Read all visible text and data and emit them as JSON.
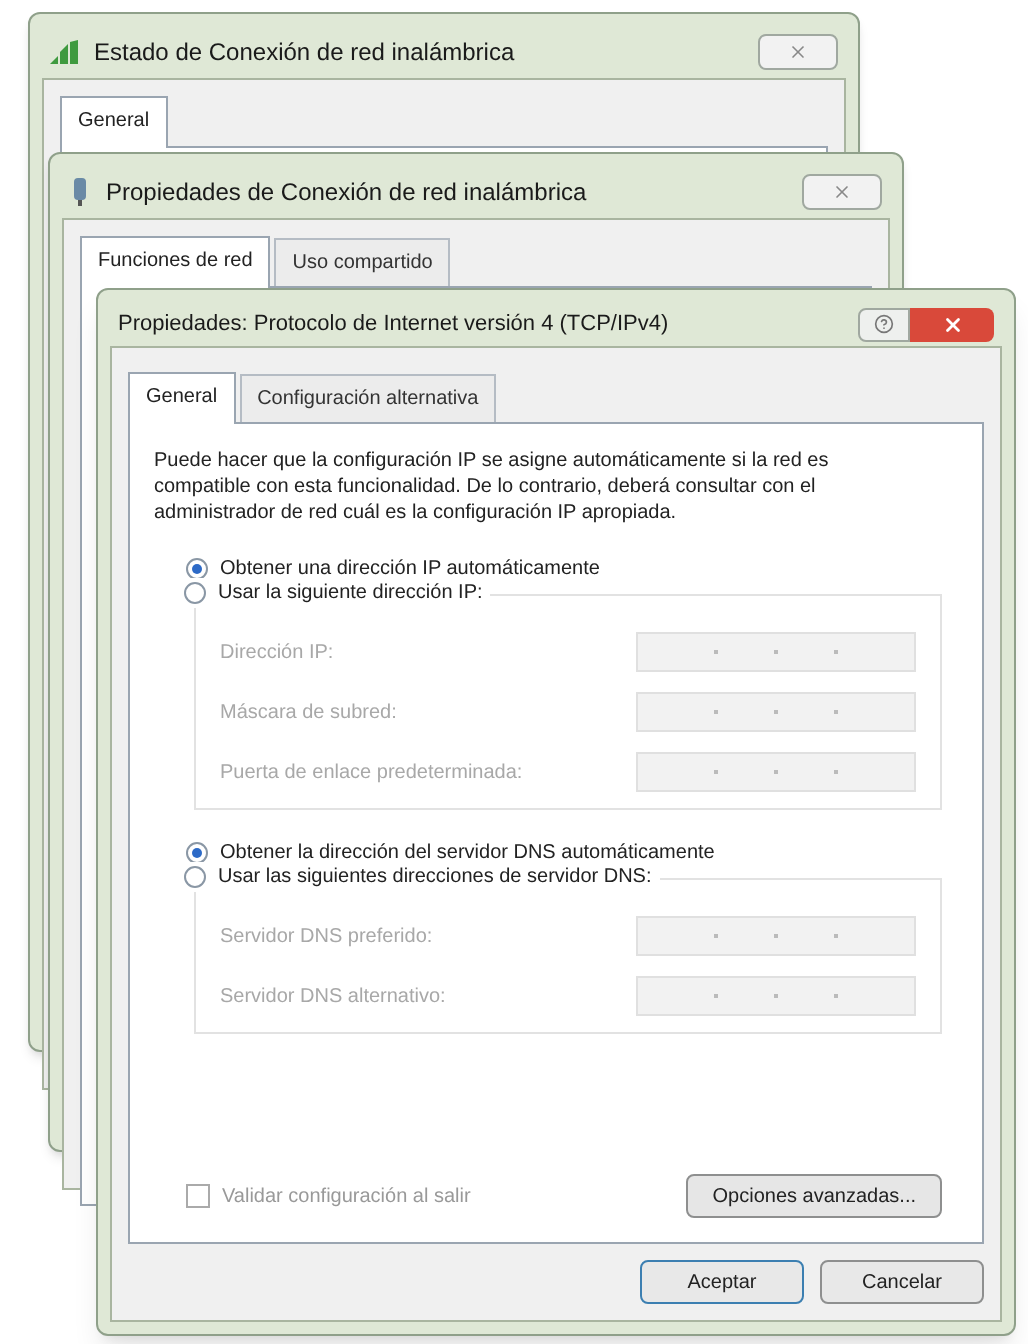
{
  "windows": [
    {
      "title": "Estado de Conexión de red inalámbrica",
      "tabs": [
        {
          "label": "General",
          "selected": true
        }
      ]
    },
    {
      "title": "Propiedades de Conexión de red inalámbrica",
      "tabs": [
        {
          "label": "Funciones de red",
          "selected": true
        },
        {
          "label": "Uso compartido",
          "selected": false
        }
      ]
    }
  ],
  "dialog": {
    "title": "Propiedades: Protocolo de Internet versión 4 (TCP/IPv4)",
    "tabs": [
      {
        "label": "General",
        "selected": true
      },
      {
        "label": "Configuración alternativa",
        "selected": false
      }
    ],
    "description": "Puede hacer que la configuración IP se asigne automáticamente si la red es compatible con esta funcionalidad. De lo contrario, deberá consultar con el administrador de red cuál es la configuración IP apropiada.",
    "groups": [
      {
        "options": [
          {
            "label": "Obtener una dirección IP automáticamente",
            "selected": true
          },
          {
            "label": "Usar la siguiente dirección IP:",
            "selected": false
          }
        ],
        "fields": [
          {
            "label": "Dirección IP:",
            "disabled": true
          },
          {
            "label": "Máscara de subred:",
            "disabled": true
          },
          {
            "label": "Puerta de enlace predeterminada:",
            "disabled": true
          }
        ]
      },
      {
        "options": [
          {
            "label": "Obtener la dirección del servidor DNS automáticamente",
            "selected": true
          },
          {
            "label": "Usar las siguientes direcciones de servidor DNS:",
            "selected": false
          }
        ],
        "fields": [
          {
            "label": "Servidor DNS preferido:",
            "disabled": true
          },
          {
            "label": "Servidor DNS alternativo:",
            "disabled": true
          }
        ]
      }
    ],
    "validate": {
      "label": "Validar configuración al salir",
      "checked": false
    },
    "advanced_button": "Opciones avanzadas...",
    "buttons": [
      "Aceptar",
      "Cancelar"
    ]
  }
}
